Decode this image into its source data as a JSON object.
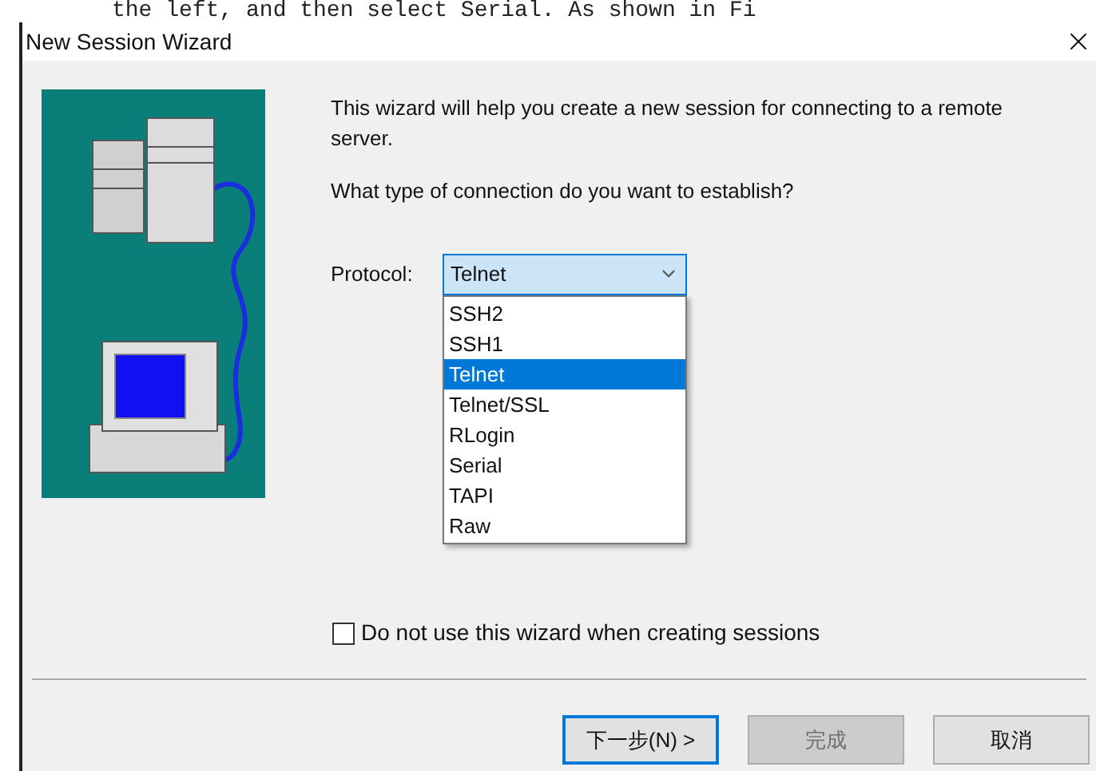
{
  "background_text": "the left, and then select Serial. As shown in Fi",
  "window": {
    "title": "New Session Wizard"
  },
  "intro": "This wizard will help you create a new session for connecting to a remote server.",
  "question": "What type of connection do you want to establish?",
  "protocol": {
    "label": "Protocol:",
    "value": "Telnet",
    "expanded": true,
    "options": [
      {
        "label": "SSH2",
        "selected": false
      },
      {
        "label": "SSH1",
        "selected": false
      },
      {
        "label": "Telnet",
        "selected": true
      },
      {
        "label": "Telnet/SSL",
        "selected": false
      },
      {
        "label": "RLogin",
        "selected": false
      },
      {
        "label": "Serial",
        "selected": false
      },
      {
        "label": "TAPI",
        "selected": false
      },
      {
        "label": "Raw",
        "selected": false
      }
    ]
  },
  "skip_wizard": {
    "label": "Do not use this wizard when creating sessions",
    "checked": false
  },
  "buttons": [
    {
      "label": "下一步(N) >",
      "default": true,
      "disabled": false
    },
    {
      "label": "完成",
      "default": false,
      "disabled": true
    },
    {
      "label": "取消",
      "default": false,
      "disabled": false
    }
  ]
}
